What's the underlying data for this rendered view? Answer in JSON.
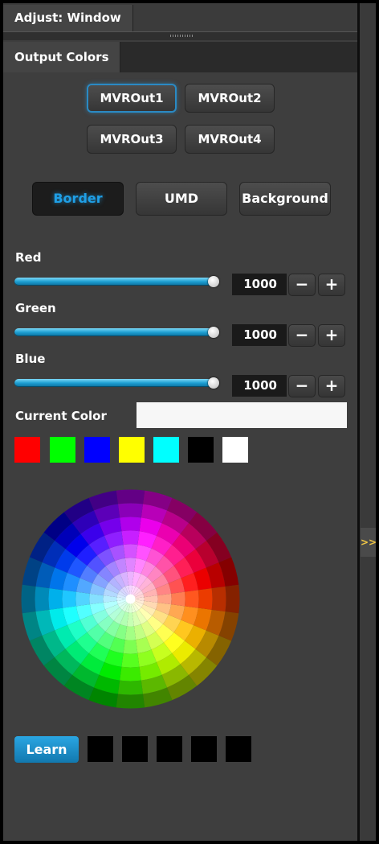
{
  "window": {
    "title": "Adjust: Window",
    "expand_label": ">>"
  },
  "tabs": {
    "active": "Output Colors"
  },
  "outputs": [
    {
      "label": "MVROut1",
      "selected": true
    },
    {
      "label": "MVROut2",
      "selected": false
    },
    {
      "label": "MVROut3",
      "selected": false
    },
    {
      "label": "MVROut4",
      "selected": false
    }
  ],
  "modes": [
    {
      "label": "Border",
      "selected": true
    },
    {
      "label": "UMD",
      "selected": false
    },
    {
      "label": "Background",
      "selected": false
    }
  ],
  "sliders": [
    {
      "label": "Red",
      "value": "1000",
      "minus": "−",
      "plus": "+",
      "level": 1.0
    },
    {
      "label": "Green",
      "value": "1000",
      "minus": "−",
      "plus": "+",
      "level": 1.0
    },
    {
      "label": "Blue",
      "value": "1000",
      "minus": "−",
      "plus": "+",
      "level": 1.0
    }
  ],
  "current_color": {
    "label": "Current Color",
    "color": "#f7f7f7"
  },
  "presets": [
    "#ff0000",
    "#00ff00",
    "#0000ff",
    "#ffff00",
    "#00ffff",
    "#000000",
    "#ffffff"
  ],
  "learn_label": "Learn",
  "memory_slots": [
    "#000000",
    "#000000",
    "#000000",
    "#000000",
    "#000000"
  ],
  "colors": {
    "accent": "#1f9fe6",
    "expand_arrow": "#f2c744"
  }
}
